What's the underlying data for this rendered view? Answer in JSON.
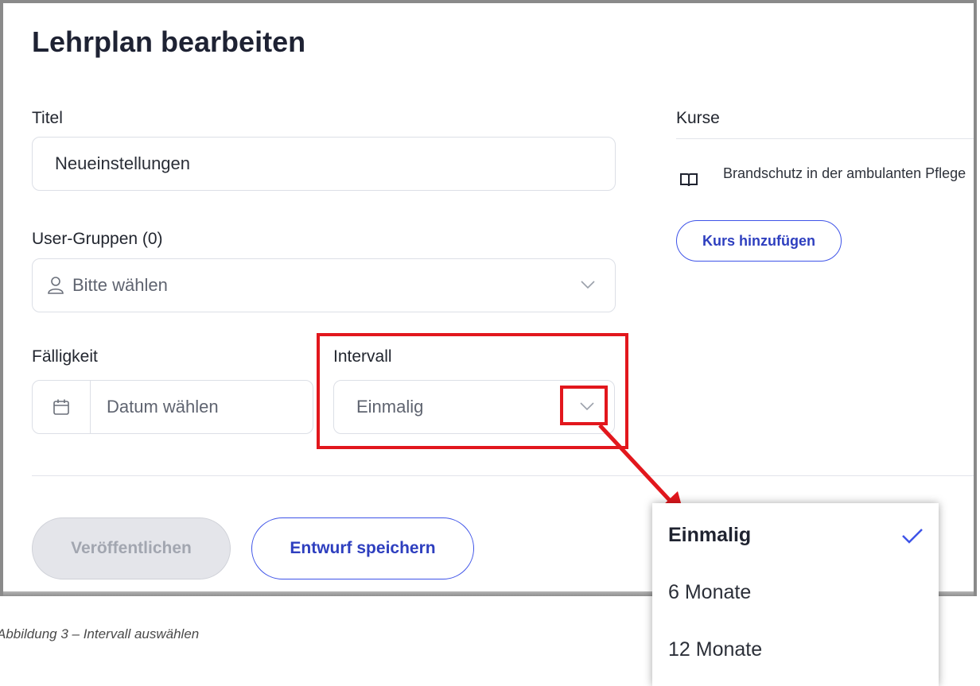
{
  "page": {
    "title": "Lehrplan bearbeiten"
  },
  "form": {
    "titel_label": "Titel",
    "titel_value": "Neueinstellungen",
    "user_groups_label": "User-Gruppen (0)",
    "user_groups_placeholder": "Bitte wählen",
    "faelligkeit_label": "Fälligkeit",
    "faelligkeit_placeholder": "Datum wählen",
    "intervall_label": "Intervall",
    "intervall_value": "Einmalig"
  },
  "courses": {
    "label": "Kurse",
    "items": [
      {
        "name": "Brandschutz in der ambulanten Pflege",
        "icon": "book-icon"
      }
    ],
    "add_button": "Kurs hinzufügen"
  },
  "actions": {
    "publish_label": "Veröffentlichen",
    "save_draft_label": "Entwurf speichern"
  },
  "dropdown": {
    "options": [
      "Einmalig",
      "6 Monate",
      "12 Monate"
    ],
    "selected": "Einmalig"
  },
  "annotation": {
    "highlight_color": "#e2171d",
    "caption": "Abbildung 3 – Intervall auswählen"
  },
  "colors": {
    "accent": "#3e53e8",
    "title": "#1e2233",
    "disabled_bg": "#e4e5ea"
  }
}
